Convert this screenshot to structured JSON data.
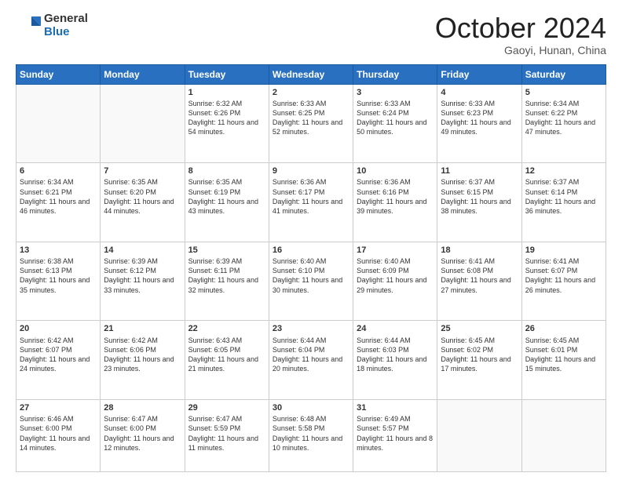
{
  "logo": {
    "general": "General",
    "blue": "Blue"
  },
  "header": {
    "month": "October 2024",
    "location": "Gaoyi, Hunan, China"
  },
  "weekdays": [
    "Sunday",
    "Monday",
    "Tuesday",
    "Wednesday",
    "Thursday",
    "Friday",
    "Saturday"
  ],
  "weeks": [
    [
      {
        "day": "",
        "info": ""
      },
      {
        "day": "",
        "info": ""
      },
      {
        "day": "1",
        "info": "Sunrise: 6:32 AM\nSunset: 6:26 PM\nDaylight: 11 hours and 54 minutes."
      },
      {
        "day": "2",
        "info": "Sunrise: 6:33 AM\nSunset: 6:25 PM\nDaylight: 11 hours and 52 minutes."
      },
      {
        "day": "3",
        "info": "Sunrise: 6:33 AM\nSunset: 6:24 PM\nDaylight: 11 hours and 50 minutes."
      },
      {
        "day": "4",
        "info": "Sunrise: 6:33 AM\nSunset: 6:23 PM\nDaylight: 11 hours and 49 minutes."
      },
      {
        "day": "5",
        "info": "Sunrise: 6:34 AM\nSunset: 6:22 PM\nDaylight: 11 hours and 47 minutes."
      }
    ],
    [
      {
        "day": "6",
        "info": "Sunrise: 6:34 AM\nSunset: 6:21 PM\nDaylight: 11 hours and 46 minutes."
      },
      {
        "day": "7",
        "info": "Sunrise: 6:35 AM\nSunset: 6:20 PM\nDaylight: 11 hours and 44 minutes."
      },
      {
        "day": "8",
        "info": "Sunrise: 6:35 AM\nSunset: 6:19 PM\nDaylight: 11 hours and 43 minutes."
      },
      {
        "day": "9",
        "info": "Sunrise: 6:36 AM\nSunset: 6:17 PM\nDaylight: 11 hours and 41 minutes."
      },
      {
        "day": "10",
        "info": "Sunrise: 6:36 AM\nSunset: 6:16 PM\nDaylight: 11 hours and 39 minutes."
      },
      {
        "day": "11",
        "info": "Sunrise: 6:37 AM\nSunset: 6:15 PM\nDaylight: 11 hours and 38 minutes."
      },
      {
        "day": "12",
        "info": "Sunrise: 6:37 AM\nSunset: 6:14 PM\nDaylight: 11 hours and 36 minutes."
      }
    ],
    [
      {
        "day": "13",
        "info": "Sunrise: 6:38 AM\nSunset: 6:13 PM\nDaylight: 11 hours and 35 minutes."
      },
      {
        "day": "14",
        "info": "Sunrise: 6:39 AM\nSunset: 6:12 PM\nDaylight: 11 hours and 33 minutes."
      },
      {
        "day": "15",
        "info": "Sunrise: 6:39 AM\nSunset: 6:11 PM\nDaylight: 11 hours and 32 minutes."
      },
      {
        "day": "16",
        "info": "Sunrise: 6:40 AM\nSunset: 6:10 PM\nDaylight: 11 hours and 30 minutes."
      },
      {
        "day": "17",
        "info": "Sunrise: 6:40 AM\nSunset: 6:09 PM\nDaylight: 11 hours and 29 minutes."
      },
      {
        "day": "18",
        "info": "Sunrise: 6:41 AM\nSunset: 6:08 PM\nDaylight: 11 hours and 27 minutes."
      },
      {
        "day": "19",
        "info": "Sunrise: 6:41 AM\nSunset: 6:07 PM\nDaylight: 11 hours and 26 minutes."
      }
    ],
    [
      {
        "day": "20",
        "info": "Sunrise: 6:42 AM\nSunset: 6:07 PM\nDaylight: 11 hours and 24 minutes."
      },
      {
        "day": "21",
        "info": "Sunrise: 6:42 AM\nSunset: 6:06 PM\nDaylight: 11 hours and 23 minutes."
      },
      {
        "day": "22",
        "info": "Sunrise: 6:43 AM\nSunset: 6:05 PM\nDaylight: 11 hours and 21 minutes."
      },
      {
        "day": "23",
        "info": "Sunrise: 6:44 AM\nSunset: 6:04 PM\nDaylight: 11 hours and 20 minutes."
      },
      {
        "day": "24",
        "info": "Sunrise: 6:44 AM\nSunset: 6:03 PM\nDaylight: 11 hours and 18 minutes."
      },
      {
        "day": "25",
        "info": "Sunrise: 6:45 AM\nSunset: 6:02 PM\nDaylight: 11 hours and 17 minutes."
      },
      {
        "day": "26",
        "info": "Sunrise: 6:45 AM\nSunset: 6:01 PM\nDaylight: 11 hours and 15 minutes."
      }
    ],
    [
      {
        "day": "27",
        "info": "Sunrise: 6:46 AM\nSunset: 6:00 PM\nDaylight: 11 hours and 14 minutes."
      },
      {
        "day": "28",
        "info": "Sunrise: 6:47 AM\nSunset: 6:00 PM\nDaylight: 11 hours and 12 minutes."
      },
      {
        "day": "29",
        "info": "Sunrise: 6:47 AM\nSunset: 5:59 PM\nDaylight: 11 hours and 11 minutes."
      },
      {
        "day": "30",
        "info": "Sunrise: 6:48 AM\nSunset: 5:58 PM\nDaylight: 11 hours and 10 minutes."
      },
      {
        "day": "31",
        "info": "Sunrise: 6:49 AM\nSunset: 5:57 PM\nDaylight: 11 hours and 8 minutes."
      },
      {
        "day": "",
        "info": ""
      },
      {
        "day": "",
        "info": ""
      }
    ]
  ]
}
